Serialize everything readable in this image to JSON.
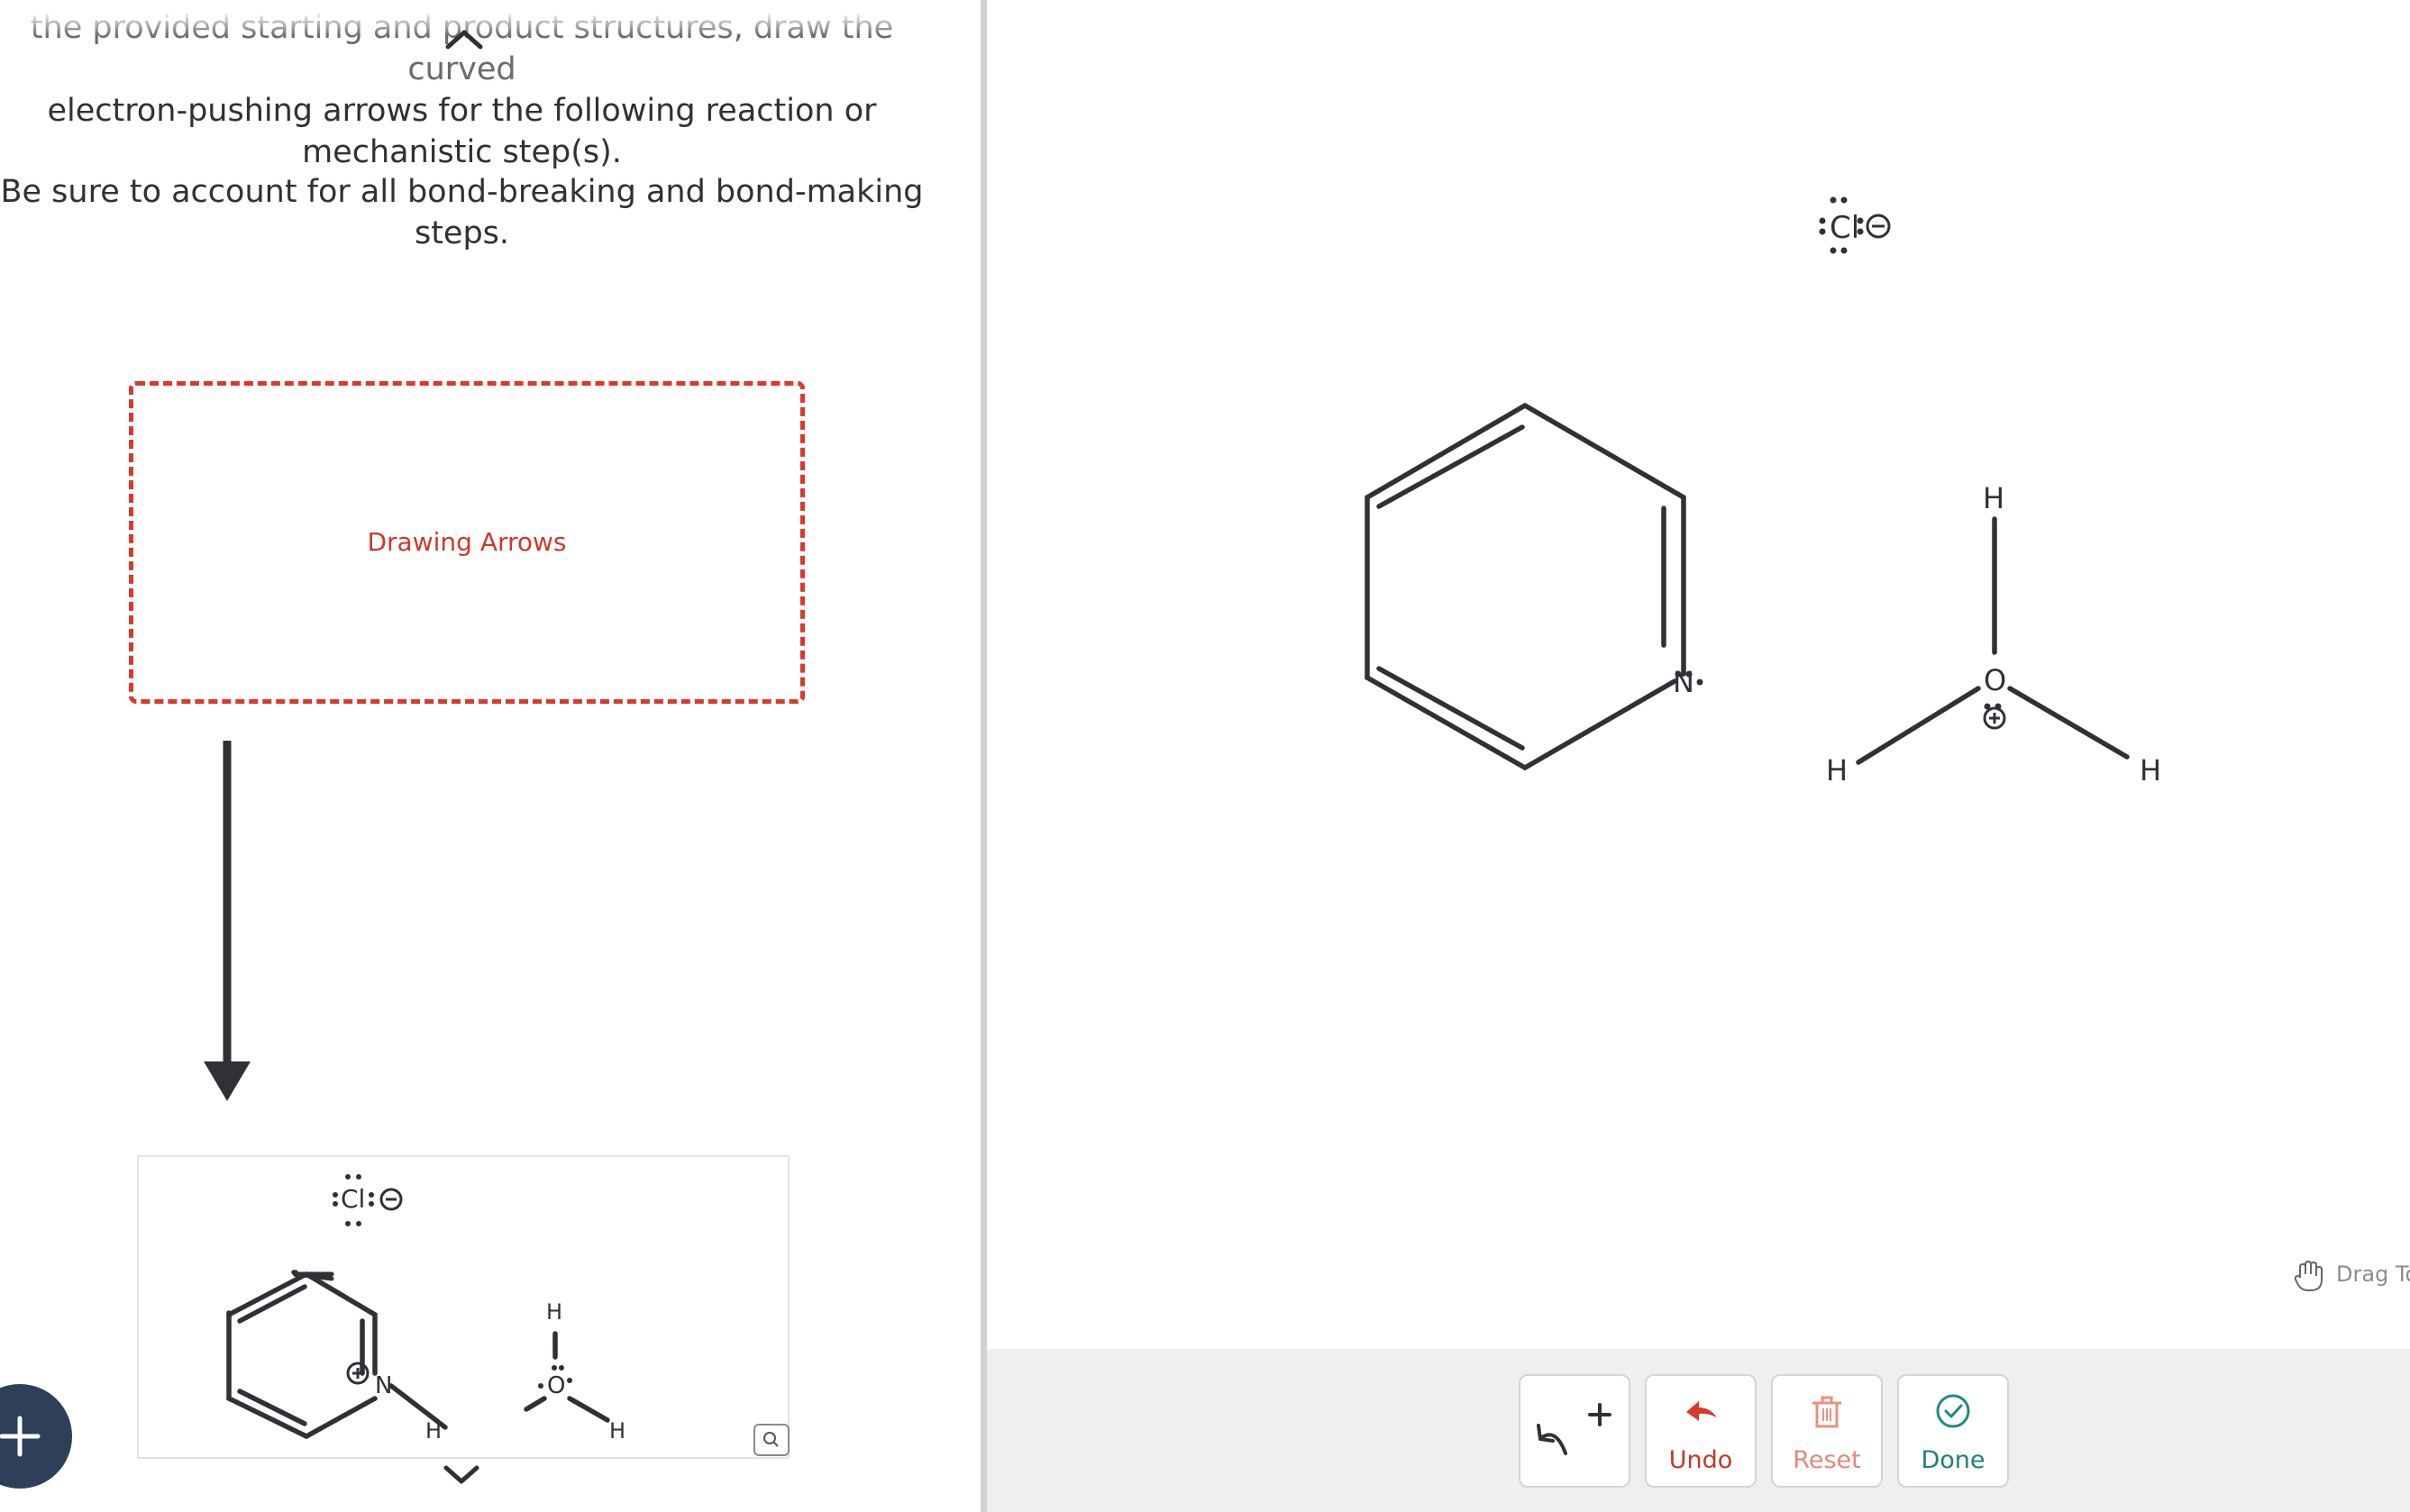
{
  "instructions": {
    "line1": "the provided starting and product structures, draw the curved",
    "line2": "electron-pushing arrows for the following reaction or",
    "line3": "mechanistic step(s).",
    "line4": "Be sure to account for all bond-breaking and bond-making",
    "line5": "steps."
  },
  "drawing_box": {
    "label": "Drawing Arrows"
  },
  "canvas": {
    "chloride": "Cl",
    "pyridine_nitrogen": "N",
    "oxonium_oxygen": "O",
    "hydrogens": [
      "H",
      "H",
      "H"
    ],
    "drag_hint": "Drag To"
  },
  "product": {
    "chloride": "Cl",
    "nitrogen": "N",
    "oxygen": "O",
    "h_on_n": "H",
    "h_top": "H",
    "h_right": "H"
  },
  "toolbar": {
    "undo_label": "Undo",
    "reset_label": "Reset",
    "done_label": "Done"
  },
  "colors": {
    "accent_red": "#d93a2b",
    "done_teal": "#1f8a84",
    "reset_salmon": "#e8907f",
    "dark": "#2f3136"
  }
}
